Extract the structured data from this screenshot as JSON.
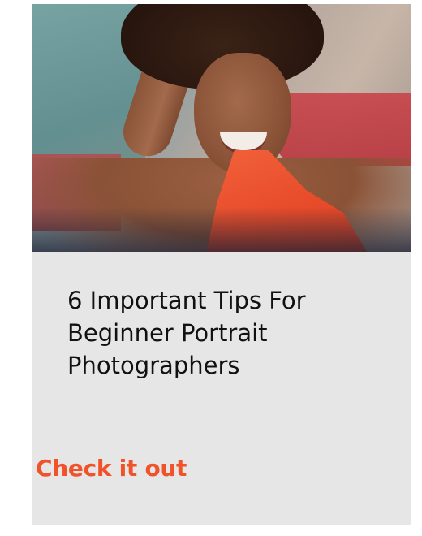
{
  "card": {
    "image": {
      "alt_subject": "portrait-photo"
    },
    "title": "6 Important Tips For Beginner Portrait Photographers",
    "cta_label": "Check it out"
  },
  "colors": {
    "card_background": "#e6e6e6",
    "title_text": "#111111",
    "cta_text": "#f0522a"
  }
}
